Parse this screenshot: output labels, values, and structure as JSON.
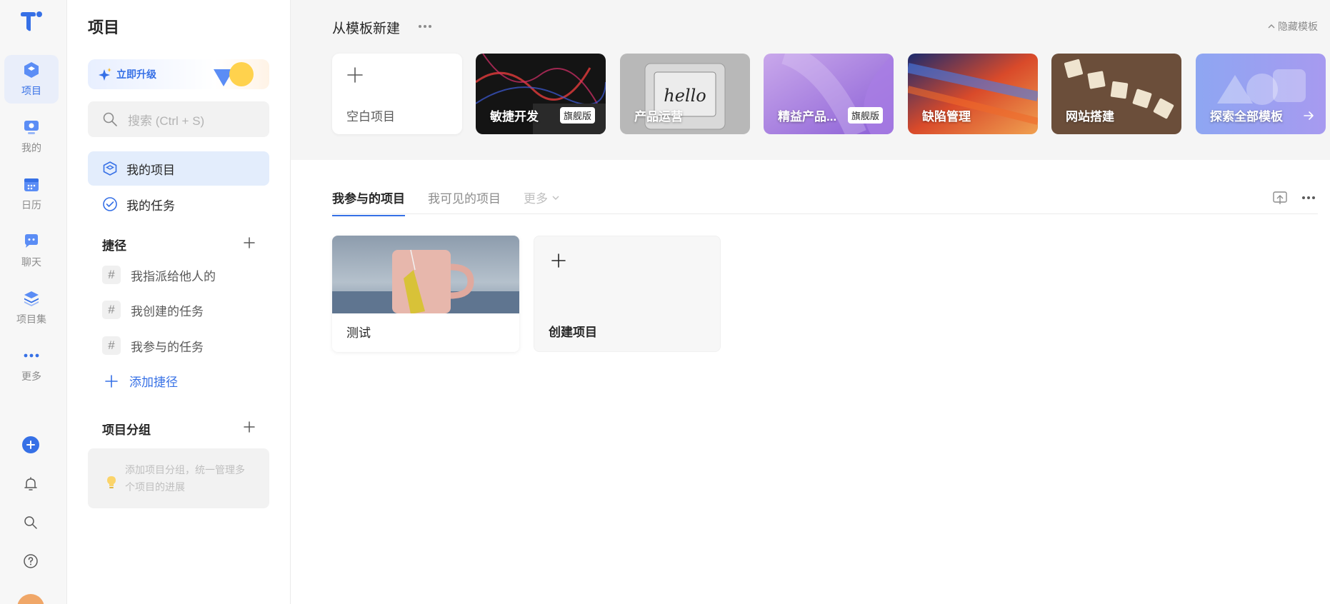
{
  "rail": {
    "items": [
      {
        "label": "项目",
        "icon": "project-icon"
      },
      {
        "label": "我的",
        "icon": "my-icon"
      },
      {
        "label": "日历",
        "icon": "calendar-icon"
      },
      {
        "label": "聊天",
        "icon": "chat-icon"
      },
      {
        "label": "项目集",
        "icon": "project-set-icon"
      },
      {
        "label": "更多",
        "icon": "more-icon"
      }
    ]
  },
  "sidebar": {
    "title": "项目",
    "upgrade_label": "立即升级",
    "search_placeholder": "搜索 (Ctrl + S)",
    "nav": [
      {
        "label": "我的项目"
      },
      {
        "label": "我的任务"
      }
    ],
    "shortcuts_title": "捷径",
    "shortcuts": [
      {
        "label": "我指派给他人的"
      },
      {
        "label": "我创建的任务"
      },
      {
        "label": "我参与的任务"
      }
    ],
    "add_shortcut_label": "添加捷径",
    "groups_title": "项目分组",
    "groups_tip": "添加项目分组，统一管理多个项目的进展"
  },
  "templates": {
    "title": "从模板新建",
    "hide_label": "隐藏模板",
    "blank_label": "空白项目",
    "cards": [
      {
        "label": "敏捷开发",
        "badge": "旗舰版"
      },
      {
        "label": "产品运营",
        "badge": ""
      },
      {
        "label": "精益产品...",
        "badge": "旗舰版"
      },
      {
        "label": "缺陷管理",
        "badge": ""
      },
      {
        "label": "网站搭建",
        "badge": ""
      },
      {
        "label": "探索全部模板",
        "badge": ""
      }
    ]
  },
  "tabs": {
    "items": [
      {
        "label": "我参与的项目"
      },
      {
        "label": "我可见的项目"
      },
      {
        "label": "更多"
      }
    ]
  },
  "projects": {
    "items": [
      {
        "label": "测试"
      }
    ],
    "create_label": "创建项目"
  },
  "colors": {
    "accent": "#3670e6",
    "active_bg": "#e3edfc"
  }
}
